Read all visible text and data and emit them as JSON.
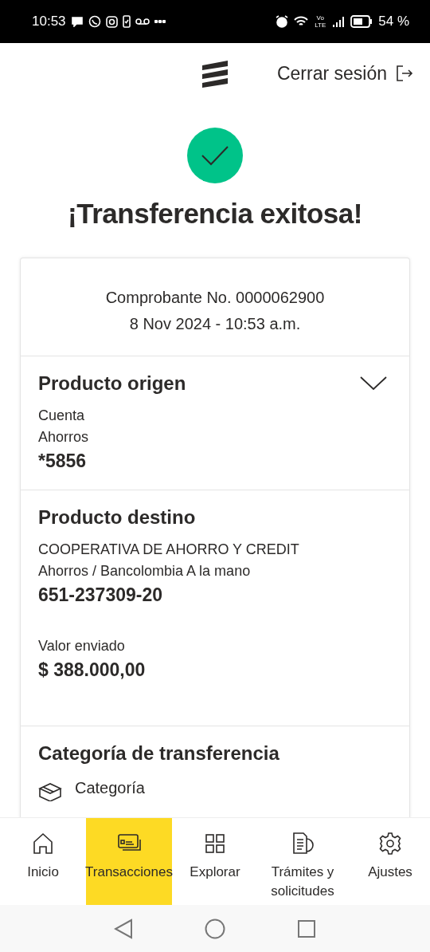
{
  "status_bar": {
    "time": "10:53",
    "network": "Vo LTE",
    "battery": "54 %"
  },
  "header": {
    "logout": "Cerrar sesión"
  },
  "title": "¡Transferencia exitosa!",
  "receipt": {
    "number": "Comprobante No. 0000062900",
    "date": "8 Nov 2024 - 10:53 a.m."
  },
  "origin": {
    "title": "Producto origen",
    "lines": [
      "Cuenta",
      "Ahorros"
    ],
    "account": "*5856"
  },
  "destination": {
    "title": "Producto destino",
    "lines": [
      "COOPERATIVA DE AHORRO Y CREDIT",
      "Ahorros / Bancolombia A la mano"
    ],
    "account": "651-237309-20",
    "amount_label": "Valor enviado",
    "amount": "$ 388.000,00"
  },
  "category": {
    "title": "Categoría de transferencia",
    "label": "Categoría"
  },
  "nav": [
    {
      "label": "Inicio",
      "selected": false
    },
    {
      "label": "Transacciones",
      "selected": true
    },
    {
      "label": "Explorar",
      "selected": false
    },
    {
      "label": "Trámites y solicitudes",
      "selected": false
    },
    {
      "label": "Ajustes",
      "selected": false
    }
  ]
}
